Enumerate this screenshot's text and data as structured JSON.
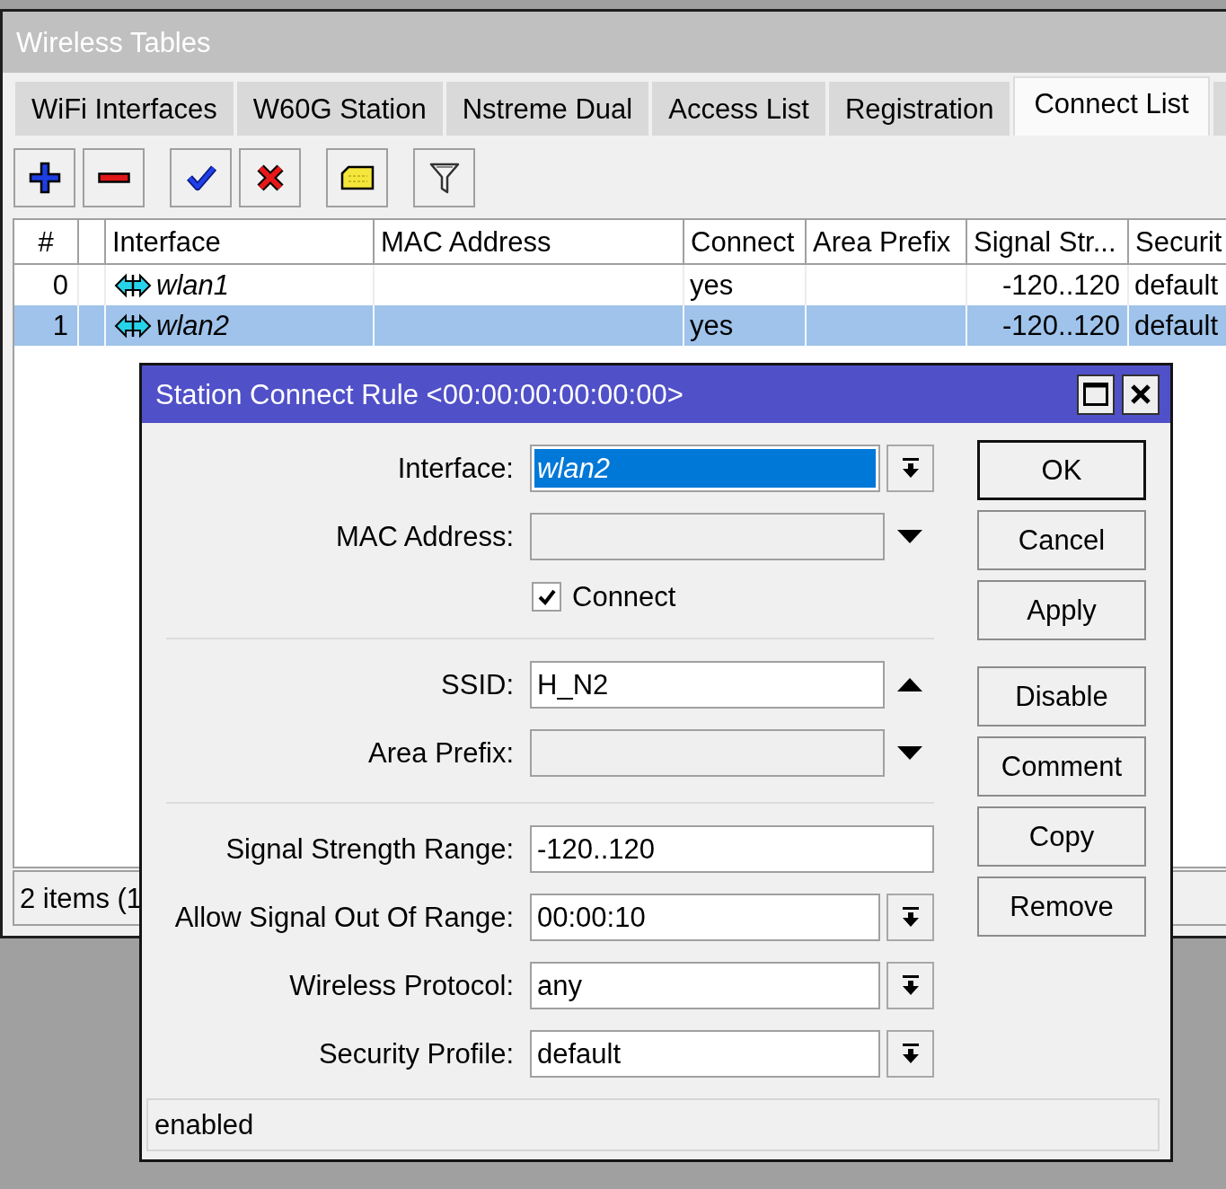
{
  "main_window": {
    "title": "Wireless Tables"
  },
  "tabs": [
    {
      "label": "WiFi Interfaces",
      "selected": false
    },
    {
      "label": "W60G Station",
      "selected": false
    },
    {
      "label": "Nstreme Dual",
      "selected": false
    },
    {
      "label": "Access List",
      "selected": false
    },
    {
      "label": "Registration",
      "selected": false
    },
    {
      "label": "Connect List",
      "selected": true
    }
  ],
  "toolbar": [
    [
      {
        "kind": "add"
      },
      {
        "kind": "remove"
      }
    ],
    [
      {
        "kind": "enable"
      },
      {
        "kind": "disable"
      }
    ],
    [
      {
        "kind": "comment"
      }
    ],
    [
      {
        "kind": "filter"
      }
    ]
  ],
  "table": {
    "columns": [
      "#",
      "Interface",
      "MAC Address",
      "Connect",
      "Area Prefix",
      "Signal Str...",
      "Securit"
    ],
    "rows": [
      {
        "cells": [
          "0",
          "wlan1",
          null,
          "yes",
          null,
          "-120..120",
          "default"
        ],
        "selected": false
      },
      {
        "cells": [
          "1",
          "wlan2",
          null,
          "yes",
          null,
          "-120..120",
          "default"
        ],
        "selected": true
      }
    ]
  },
  "status_bar": "2 items (1",
  "dialog": {
    "title": "Station Connect Rule <00:00:00:00:00:00>",
    "field_groups": [
      [
        {
          "kind": "select",
          "label": "Interface:",
          "value": "wlan2",
          "text_selected": true,
          "italic": true
        },
        {
          "kind": "optional",
          "label": "MAC Address:",
          "active": false
        },
        {
          "kind": "checkbox",
          "label": "Connect",
          "checked": true
        }
      ],
      [
        {
          "kind": "optional",
          "label": "SSID:",
          "value": "H_N2",
          "active": true
        },
        {
          "kind": "optional",
          "label": "Area Prefix:",
          "active": false
        }
      ],
      [
        {
          "kind": "text",
          "label": "Signal Strength Range:",
          "value": "-120..120"
        },
        {
          "kind": "select",
          "label": "Allow Signal Out Of Range:",
          "value": "00:00:10",
          "text_selected": false,
          "italic": false
        },
        {
          "kind": "select",
          "label": "Wireless Protocol:",
          "value": "any",
          "text_selected": false,
          "italic": false
        },
        {
          "kind": "select",
          "label": "Security Profile:",
          "value": "default",
          "text_selected": false,
          "italic": false
        }
      ]
    ],
    "button_groups": [
      [
        {
          "label": "OK",
          "default": true
        },
        {
          "label": "Cancel",
          "default": false
        },
        {
          "label": "Apply",
          "default": false
        }
      ],
      [
        {
          "label": "Disable",
          "default": false
        },
        {
          "label": "Comment",
          "default": false
        },
        {
          "label": "Copy",
          "default": false
        },
        {
          "label": "Remove",
          "default": false
        }
      ]
    ],
    "status": "enabled"
  }
}
